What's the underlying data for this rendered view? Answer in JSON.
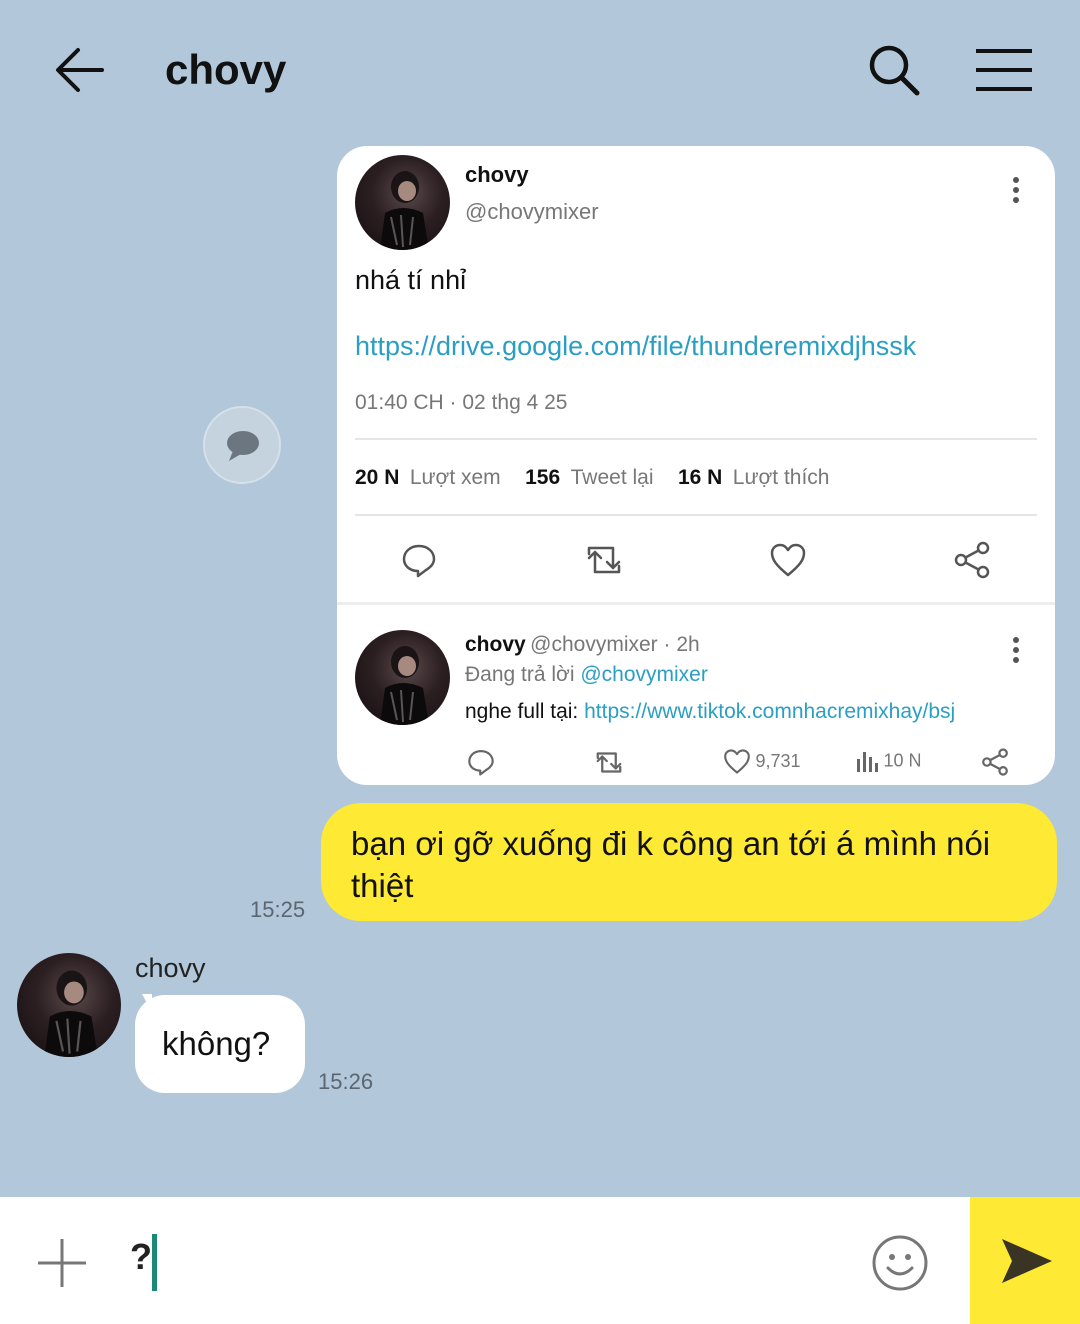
{
  "header": {
    "title": "chovy",
    "icons": [
      "back-arrow-icon",
      "search-icon",
      "menu-icon"
    ]
  },
  "tweet": {
    "name": "chovy",
    "handle": "@chovymixer",
    "text": "nhá tí nhỉ",
    "link": "https://drive.google.com/file/thunderemixdjhssk",
    "timestamp": "01:40 CH · 02 thg 4 25",
    "stats": {
      "views_num": "20 N",
      "views_label": "Lượt xem",
      "retweets_num": "156",
      "retweets_label": "Tweet lại",
      "likes_num": "16 N",
      "likes_label": "Lượt thích"
    },
    "reply": {
      "name": "chovy",
      "handle_time": "@chovymixer · 2h",
      "replying_prefix": "Đang trả lời ",
      "replying_to": "@chovymixer",
      "text_prefix": "nghe full tại: ",
      "text_link": "https://www.tiktok.comnhacremixhay/bsj",
      "like_count": "9,731",
      "view_count": "10 N"
    }
  },
  "messages": {
    "outgoing": {
      "text": "bạn ơi gỡ xuống đi k công an tới á mình nói thiệt",
      "time": "15:25"
    },
    "incoming": {
      "sender": "chovy",
      "text": "không?",
      "time": "15:26"
    }
  },
  "input": {
    "value": "?"
  },
  "colors": {
    "background": "#b2c7da",
    "accent_yellow": "#fee934",
    "link": "#2b9fc3",
    "caret": "#1a8a76"
  }
}
